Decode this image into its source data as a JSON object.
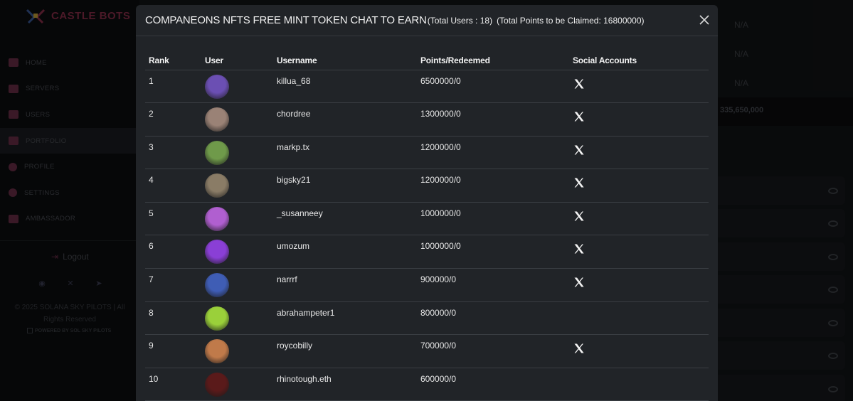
{
  "sidebar": {
    "brand": "CASTLE BOTS",
    "items": [
      {
        "label": "HOME",
        "icon": "home-icon"
      },
      {
        "label": "SERVERS",
        "icon": "servers-icon"
      },
      {
        "label": "USERS",
        "icon": "users-icon"
      },
      {
        "label": "PORTFOLIO",
        "icon": "portfolio-icon"
      },
      {
        "label": "PROFILE",
        "icon": "profile-icon"
      },
      {
        "label": "SETTINGS",
        "icon": "settings-icon"
      },
      {
        "label": "AMBASSADOR",
        "icon": "ambassador-icon"
      }
    ],
    "logout_label": "Logout",
    "footer": "© 2025 SOLANA SKY PILOTS | All Rights Reserved",
    "powered": "POWERED BY SOL SKY PILOTS"
  },
  "background": {
    "na_values": [
      "N/A",
      "N/A",
      "N/A"
    ],
    "total": "335,650,000"
  },
  "modal": {
    "title": "COMPANEONS NFTS FREE MINT TOKEN CHAT TO EARN",
    "total_users": "(Total Users : 18)",
    "total_points": "(Total Points to be Claimed: 16800000)",
    "columns": [
      "Rank",
      "User",
      "Username",
      "Points/Redeemed",
      "Social Accounts"
    ],
    "rows": [
      {
        "rank": "1",
        "username": "killua_68",
        "points": "6500000/0",
        "x": true,
        "avatar_color": "#6b4fb3"
      },
      {
        "rank": "2",
        "username": "chordree",
        "points": "1300000/0",
        "x": true,
        "avatar_color": "#9a8276"
      },
      {
        "rank": "3",
        "username": "markp.tx",
        "points": "1200000/0",
        "x": true,
        "avatar_color": "#6f9a4a"
      },
      {
        "rank": "4",
        "username": "bigsky21",
        "points": "1200000/0",
        "x": true,
        "avatar_color": "#8a7c66"
      },
      {
        "rank": "5",
        "username": "_susanneey",
        "points": "1000000/0",
        "x": true,
        "avatar_color": "#b05fd0"
      },
      {
        "rank": "6",
        "username": "umozum",
        "points": "1000000/0",
        "x": true,
        "avatar_color": "#8a3fd6"
      },
      {
        "rank": "7",
        "username": "narrrf",
        "points": "900000/0",
        "x": true,
        "avatar_color": "#3f5db5"
      },
      {
        "rank": "8",
        "username": "abrahampeter1",
        "points": "800000/0",
        "x": false,
        "avatar_color": "#9ad03a"
      },
      {
        "rank": "9",
        "username": "roycobilly",
        "points": "700000/0",
        "x": true,
        "avatar_color": "#c07a4a"
      },
      {
        "rank": "10",
        "username": "rhinotough.eth",
        "points": "600000/0",
        "x": false,
        "avatar_color": "#5a1a1a"
      }
    ]
  }
}
